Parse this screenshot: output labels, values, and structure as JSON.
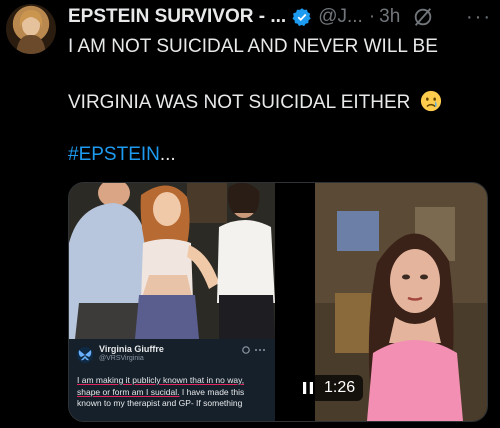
{
  "post": {
    "author_name": "EPSTEIN SURVIVOR - ...",
    "handle": "@J...",
    "separator": "·",
    "time": "3h",
    "more": "···",
    "lines": [
      "I AM NOT SUICIDAL AND NEVER WILL BE",
      "VIRGINIA WAS NOT SUICIDAL EITHER"
    ],
    "hashtag": "#EPSTEIN",
    "ellipsis": "..."
  },
  "embedded_tweet": {
    "name": "Virginia Giuffre",
    "handle": "@VRSVirginia",
    "body_underlined": "I am making it publicly known that in no way, shape or form am I sucidal.",
    "body_rest": " I have made this known to my therapist and GP- If something"
  },
  "video": {
    "duration": "1:26"
  },
  "colors": {
    "accent": "#1d9bf0",
    "muted": "#71767b",
    "background": "#000000"
  }
}
